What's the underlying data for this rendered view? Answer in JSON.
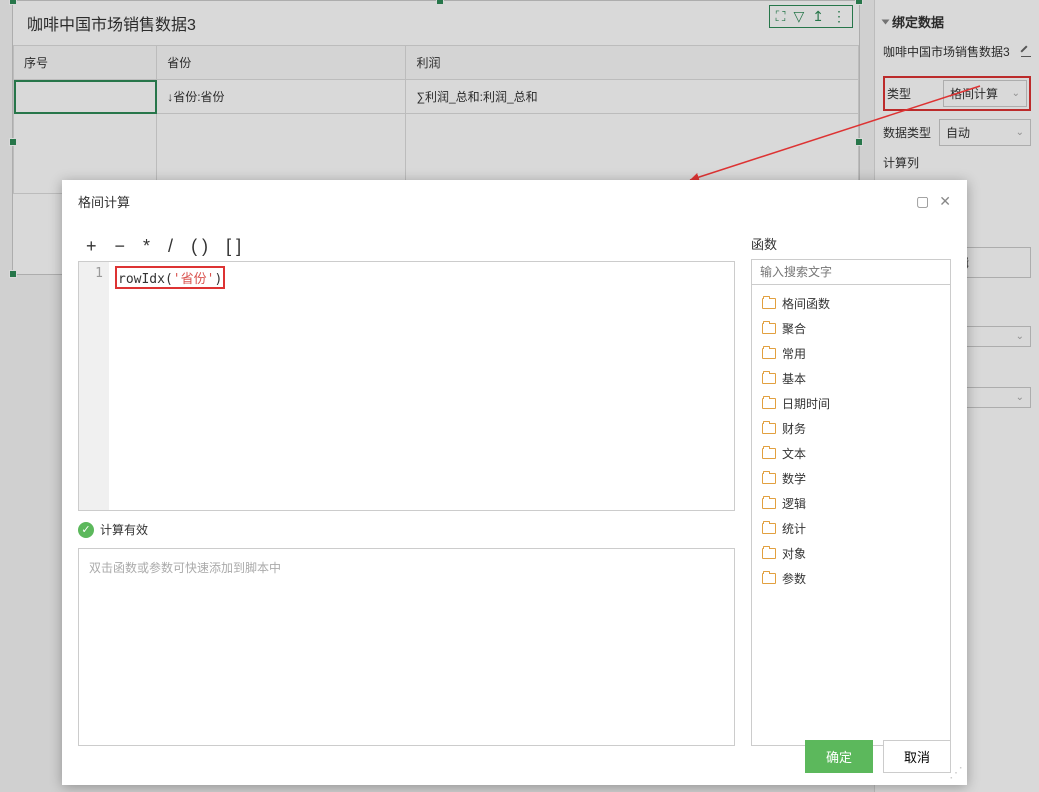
{
  "widget": {
    "title": "咖啡中国市场销售数据3",
    "columns": [
      "序号",
      "省份",
      "利润"
    ],
    "data_row": [
      "",
      "↓省份:省份",
      "∑利润_总和:利润_总和"
    ]
  },
  "toolbar": {
    "expand": "⛶",
    "filter": "▽",
    "export": "⇧",
    "more": "⋮"
  },
  "sidebar": {
    "title": "绑定数据",
    "dataset": "咖啡中国市场销售数据3",
    "type_label": "类型",
    "type_value": "格间计算",
    "datatype_label": "数据类型",
    "datatype_value": "自动",
    "calc_col_label": "计算列",
    "edit_btn": "编辑"
  },
  "modal": {
    "title": "格间计算",
    "operators": [
      "+",
      "−",
      "*",
      "/",
      "( )",
      "[ ]"
    ],
    "code": {
      "line": "1",
      "func": "rowIdx",
      "arg": "'省份'"
    },
    "valid_msg": "计算有效",
    "help_placeholder": "双击函数或参数可快速添加到脚本中",
    "func_label": "函数",
    "search_placeholder": "输入搜索文字",
    "functions": [
      "格间函数",
      "聚合",
      "常用",
      "基本",
      "日期时间",
      "财务",
      "文本",
      "数学",
      "逻辑",
      "统计",
      "对象",
      "参数"
    ],
    "ok": "确定",
    "cancel": "取消"
  }
}
